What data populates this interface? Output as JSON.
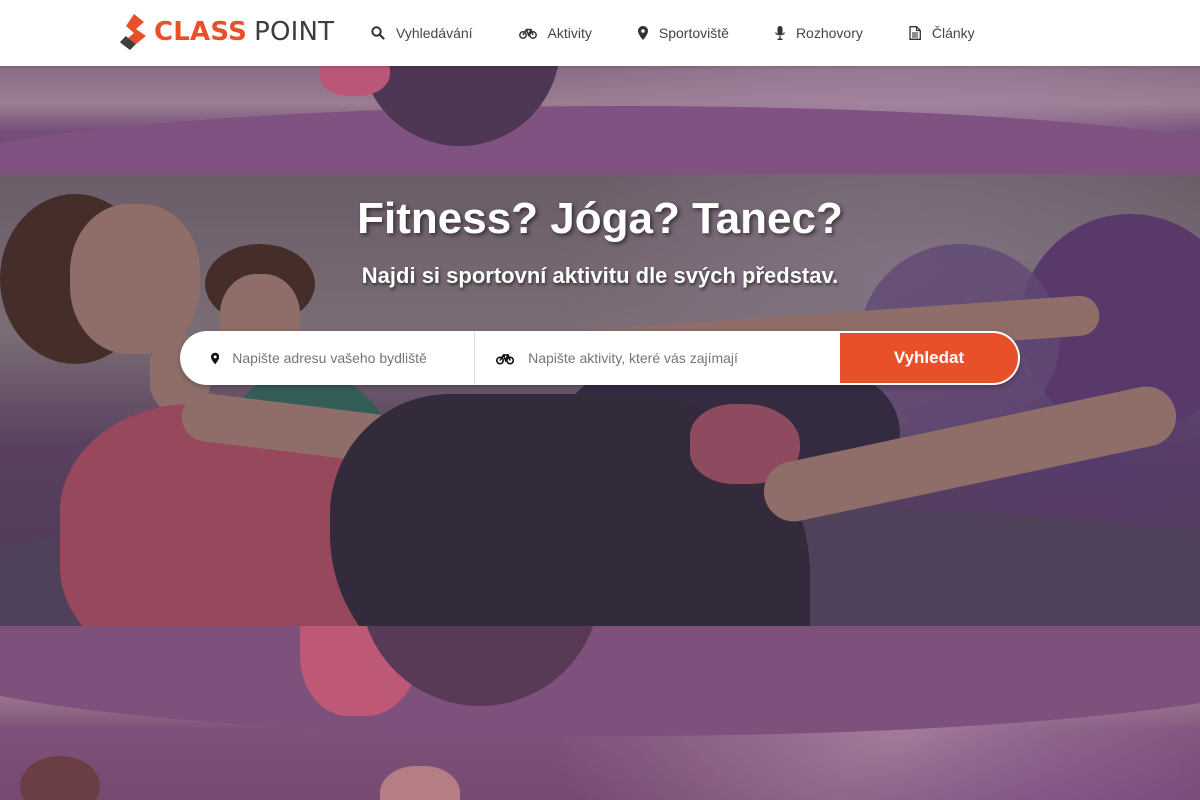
{
  "brand": {
    "name_part1": "CLASS",
    "name_part2": "POINT",
    "primary_color": "#e8502a",
    "dark_color": "#3d3d3d"
  },
  "nav": {
    "items": [
      {
        "label": "Vyhledávání",
        "icon": "search-icon"
      },
      {
        "label": "Aktivity",
        "icon": "bicycle-icon"
      },
      {
        "label": "Sportoviště",
        "icon": "map-marker-icon"
      },
      {
        "label": "Rozhovory",
        "icon": "microphone-icon"
      },
      {
        "label": "Články",
        "icon": "document-icon"
      }
    ]
  },
  "hero": {
    "title": "Fitness? Jóga? Tanec?",
    "subtitle": "Najdi si sportovní aktivitu dle svých představ."
  },
  "search": {
    "address_placeholder": "Napište adresu vašeho bydliště",
    "address_value": "",
    "activity_placeholder": "Napište aktivity, které vás zajímají",
    "activity_value": "",
    "button_label": "Vyhledat"
  }
}
